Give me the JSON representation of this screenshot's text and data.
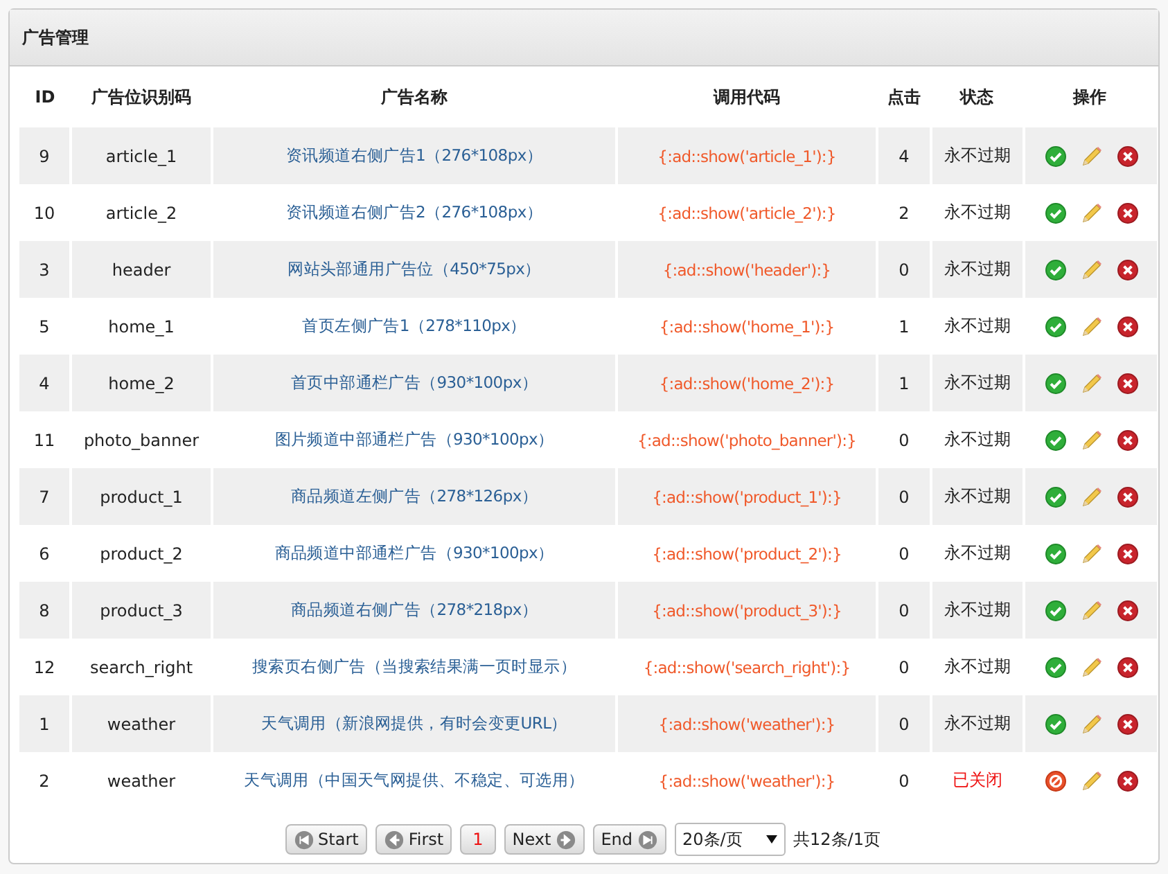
{
  "panel": {
    "title": "广告管理"
  },
  "table": {
    "columns": [
      "ID",
      "广告位识别码",
      "广告名称",
      "调用代码",
      "点击",
      "状态",
      "操作"
    ],
    "rows": [
      {
        "id": "9",
        "code": "article_1",
        "name": "资讯频道右侧广告1（276*108px）",
        "call": "{:ad::show('article_1'):}",
        "clicks": "4",
        "status": "永不过期",
        "enabled": true
      },
      {
        "id": "10",
        "code": "article_2",
        "name": "资讯频道右侧广告2（276*108px）",
        "call": "{:ad::show('article_2'):}",
        "clicks": "2",
        "status": "永不过期",
        "enabled": true
      },
      {
        "id": "3",
        "code": "header",
        "name": "网站头部通用广告位（450*75px）",
        "call": "{:ad::show('header'):}",
        "clicks": "0",
        "status": "永不过期",
        "enabled": true
      },
      {
        "id": "5",
        "code": "home_1",
        "name": "首页左侧广告1（278*110px）",
        "call": "{:ad::show('home_1'):}",
        "clicks": "1",
        "status": "永不过期",
        "enabled": true
      },
      {
        "id": "4",
        "code": "home_2",
        "name": "首页中部通栏广告（930*100px）",
        "call": "{:ad::show('home_2'):}",
        "clicks": "1",
        "status": "永不过期",
        "enabled": true
      },
      {
        "id": "11",
        "code": "photo_banner",
        "name": "图片频道中部通栏广告（930*100px）",
        "call": "{:ad::show('photo_banner'):}",
        "clicks": "0",
        "status": "永不过期",
        "enabled": true
      },
      {
        "id": "7",
        "code": "product_1",
        "name": "商品频道左侧广告（278*126px）",
        "call": "{:ad::show('product_1'):}",
        "clicks": "0",
        "status": "永不过期",
        "enabled": true
      },
      {
        "id": "6",
        "code": "product_2",
        "name": "商品频道中部通栏广告（930*100px）",
        "call": "{:ad::show('product_2'):}",
        "clicks": "0",
        "status": "永不过期",
        "enabled": true
      },
      {
        "id": "8",
        "code": "product_3",
        "name": "商品频道右侧广告（278*218px）",
        "call": "{:ad::show('product_3'):}",
        "clicks": "0",
        "status": "永不过期",
        "enabled": true
      },
      {
        "id": "12",
        "code": "search_right",
        "name": "搜索页右侧广告（当搜索结果满一页时显示）",
        "call": "{:ad::show('search_right'):}",
        "clicks": "0",
        "status": "永不过期",
        "enabled": true
      },
      {
        "id": "1",
        "code": "weather",
        "name": "天气调用（新浪网提供，有时会变更URL）",
        "call": "{:ad::show('weather'):}",
        "clicks": "0",
        "status": "永不过期",
        "enabled": true
      },
      {
        "id": "2",
        "code": "weather",
        "name": "天气调用（中国天气网提供、不稳定、可选用）",
        "call": "{:ad::show('weather'):}",
        "clicks": "0",
        "status": "已关闭",
        "enabled": false
      }
    ]
  },
  "pagination": {
    "buttons": [
      {
        "label": "Start",
        "kind": "start"
      },
      {
        "label": "First",
        "kind": "prev"
      },
      {
        "label": "1",
        "kind": "page",
        "selected": true
      },
      {
        "label": "Next",
        "kind": "next"
      },
      {
        "label": "End",
        "kind": "end"
      }
    ],
    "page_size": "20条/页",
    "summary": "共12条/1页"
  }
}
